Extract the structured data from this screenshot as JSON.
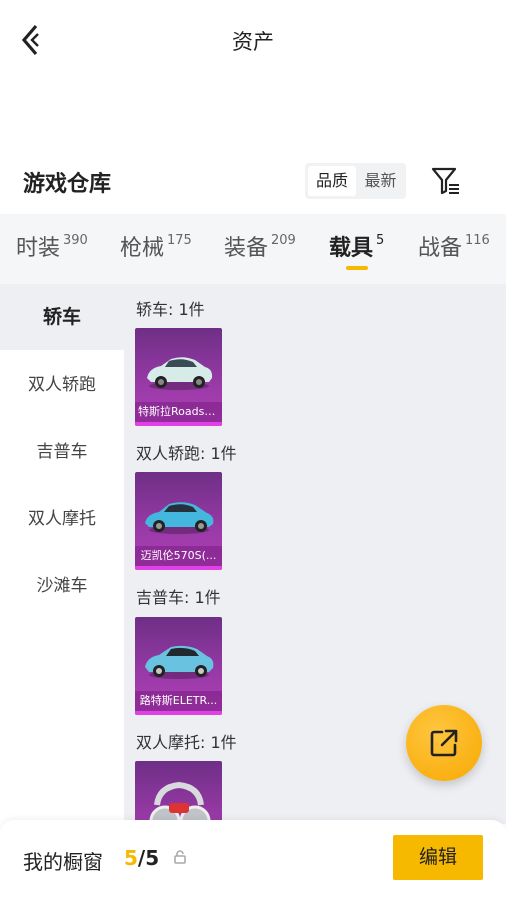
{
  "header": {
    "title": "资产"
  },
  "section": {
    "title": "游戏仓库",
    "sort_options": [
      "品质",
      "最新"
    ]
  },
  "tabs": [
    {
      "label": "时装",
      "count": "390"
    },
    {
      "label": "枪械",
      "count": "175"
    },
    {
      "label": "装备",
      "count": "209"
    },
    {
      "label": "载具",
      "count": "5",
      "active": true
    },
    {
      "label": "战备",
      "count": "116"
    }
  ],
  "categories": [
    {
      "label": "轿车",
      "active": true
    },
    {
      "label": "双人轿跑"
    },
    {
      "label": "吉普车"
    },
    {
      "label": "双人摩托"
    },
    {
      "label": "沙滩车"
    }
  ],
  "groups": [
    {
      "title": "轿车: 1件",
      "item_name": "特斯拉Roadster",
      "car_color": "#d7ece9"
    },
    {
      "title": "双人轿跑: 1件",
      "item_name": "迈凯伦570S(...",
      "car_color": "#43b7dd"
    },
    {
      "title": "吉普车: 1件",
      "item_name": "路特斯ELETR...",
      "car_color": "#69c3e0"
    },
    {
      "title": "双人摩托: 1件",
      "item_name": "",
      "car_color": "#c0c4c8"
    }
  ],
  "showcase": {
    "label": "我的橱窗",
    "current": "5",
    "separator": "/",
    "total": "5"
  },
  "edit_button": "编辑",
  "colors": {
    "accent": "#f7b800",
    "card_purple": "#9a3aa8",
    "panel_bg": "#edeff2"
  }
}
